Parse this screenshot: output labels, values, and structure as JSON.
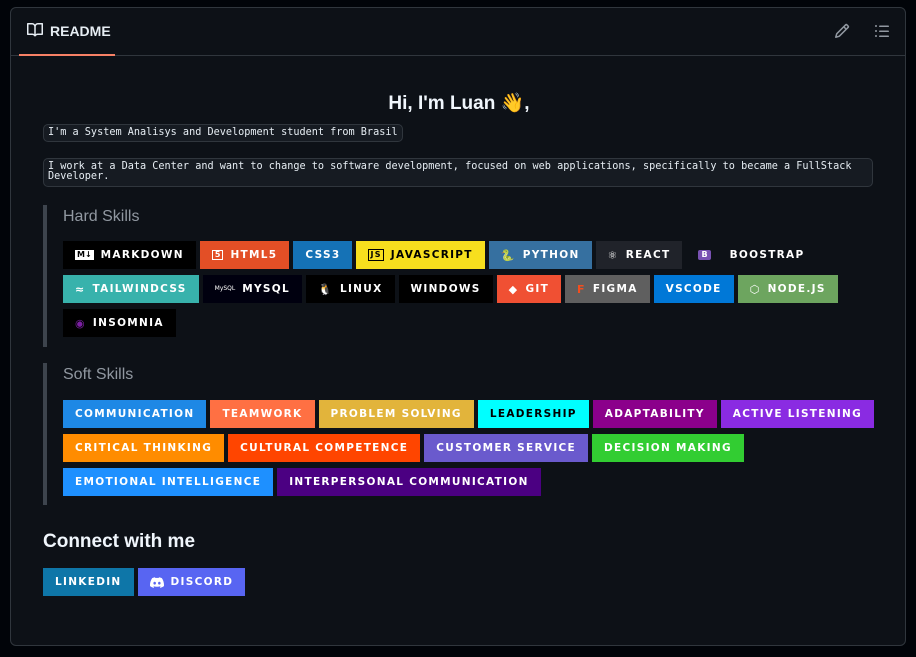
{
  "header": {
    "tab_label": "README"
  },
  "greeting": "Hi, I'm Luan 👋,",
  "intro_line": "I'm a System Analisys and Development student from Brasil",
  "work_line": "I work at a Data Center and want to change to software development, focused on web applications, specifically to became a FullStack Developer.",
  "hard_skills": {
    "title": "Hard Skills",
    "badges": [
      {
        "label": "MARKDOWN",
        "bg": "#000000",
        "fg": "#ffffff",
        "icon": "M↓"
      },
      {
        "label": "HTML5",
        "bg": "#e34f26",
        "fg": "#ffffff",
        "icon": "5"
      },
      {
        "label": "CSS3",
        "bg": "#1572b6",
        "fg": "#ffffff",
        "icon": ""
      },
      {
        "label": "JAVASCRIPT",
        "bg": "#f7df1e",
        "fg": "#000000",
        "icon": "JS"
      },
      {
        "label": "PYTHON",
        "bg": "#3670a0",
        "fg": "#ffffff",
        "icon": "🐍"
      },
      {
        "label": "REACT",
        "bg": "#20232a",
        "fg": "#ffffff",
        "icon": "⚛"
      },
      {
        "label": "BOOSTRAP",
        "bg": "#0d1117",
        "fg": "#ffffff",
        "icon": "B"
      },
      {
        "label": "TAILWINDCSS",
        "bg": "#38b2ac",
        "fg": "#ffffff",
        "icon": "≈"
      },
      {
        "label": "MYSQL",
        "bg": "#00000f",
        "fg": "#ffffff",
        "icon": "MySQL"
      },
      {
        "label": "LINUX",
        "bg": "#000000",
        "fg": "#ffffff",
        "icon": "🐧"
      },
      {
        "label": "WINDOWS",
        "bg": "#000000",
        "fg": "#ffffff",
        "icon": ""
      },
      {
        "label": "GIT",
        "bg": "#f05033",
        "fg": "#ffffff",
        "icon": "◆"
      },
      {
        "label": "FIGMA",
        "bg": "#5f5f5f",
        "fg": "#ffffff",
        "icon": "F"
      },
      {
        "label": "VSCODE",
        "bg": "#0078d7",
        "fg": "#ffffff",
        "icon": ""
      },
      {
        "label": "NODE.JS",
        "bg": "#6da55f",
        "fg": "#ffffff",
        "icon": "⬡"
      },
      {
        "label": "INSOMNIA",
        "bg": "#000000",
        "fg": "#ffffff",
        "icon": "◉"
      }
    ]
  },
  "soft_skills": {
    "title": "Soft Skills",
    "badges": [
      {
        "label": "COMMUNICATION",
        "bg": "#1e88e5",
        "fg": "#ffffff"
      },
      {
        "label": "TEAMWORK",
        "bg": "#ff7043",
        "fg": "#ffffff"
      },
      {
        "label": "PROBLEM SOLVING",
        "bg": "#e2b43b",
        "fg": "#ffffff"
      },
      {
        "label": "LEADERSHIP",
        "bg": "#00ffff",
        "fg": "#000000"
      },
      {
        "label": "ADAPTABILITY",
        "bg": "#8b008b",
        "fg": "#ffffff"
      },
      {
        "label": "ACTIVE LISTENING",
        "bg": "#8a2be2",
        "fg": "#ffffff"
      },
      {
        "label": "CRITICAL THINKING",
        "bg": "#ff8c00",
        "fg": "#ffffff"
      },
      {
        "label": "CULTURAL COMPETENCE",
        "bg": "#ff4500",
        "fg": "#ffffff"
      },
      {
        "label": "CUSTOMER SERVICE",
        "bg": "#6a5acd",
        "fg": "#ffffff"
      },
      {
        "label": "DECISION MAKING",
        "bg": "#32cd32",
        "fg": "#ffffff"
      },
      {
        "label": "EMOTIONAL INTELLIGENCE",
        "bg": "#1e90ff",
        "fg": "#ffffff"
      },
      {
        "label": "INTERPERSONAL COMMUNICATION",
        "bg": "#4b0082",
        "fg": "#ffffff"
      }
    ]
  },
  "connect": {
    "title": "Connect with me",
    "badges": [
      {
        "label": "LINKEDIN",
        "bg": "#0e76a8",
        "fg": "#ffffff",
        "icon": ""
      },
      {
        "label": "DISCORD",
        "bg": "#5865f2",
        "fg": "#ffffff",
        "icon": "discord"
      }
    ]
  },
  "colors": {
    "tab_underline": "#f78166",
    "page_bg": "#0d1117",
    "border": "#30363d"
  },
  "icons": {
    "tab": "book-icon",
    "edit": "pencil-icon",
    "outline": "list-icon"
  }
}
